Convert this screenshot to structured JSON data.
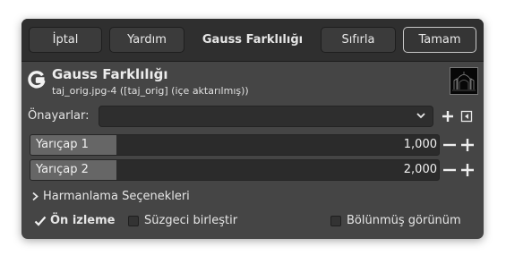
{
  "header": {
    "cancel_label": "İptal",
    "help_label": "Yardım",
    "title": "Gauss Farklılığı",
    "reset_label": "Sıfırla",
    "ok_label": "Tamam"
  },
  "operation": {
    "title": "Gauss Farklılığı",
    "subtitle": "taj_orig.jpg-4 ([taj_orig] (içe aktarılmış))"
  },
  "presets": {
    "label": "Önayarlar:",
    "value": ""
  },
  "sliders": [
    {
      "label": "Yarıçap 1",
      "value": "1,000",
      "fill_fraction": 0.21
    },
    {
      "label": "Yarıçap 2",
      "value": "2,000",
      "fill_fraction": 0.21
    }
  ],
  "blending": {
    "label": "Harmanlama Seçenekleri"
  },
  "options": {
    "preview_label": "Ön izleme",
    "preview_checked": true,
    "merge_label": "Süzgeci birleştir",
    "merge_checked": false,
    "split_label": "Bölünmüş görünüm",
    "split_checked": false
  },
  "colors": {
    "dialog_bg": "#454545",
    "header_bg": "#2f2f2f",
    "slider_fill": "#666666",
    "text": "#e6e6e6"
  }
}
